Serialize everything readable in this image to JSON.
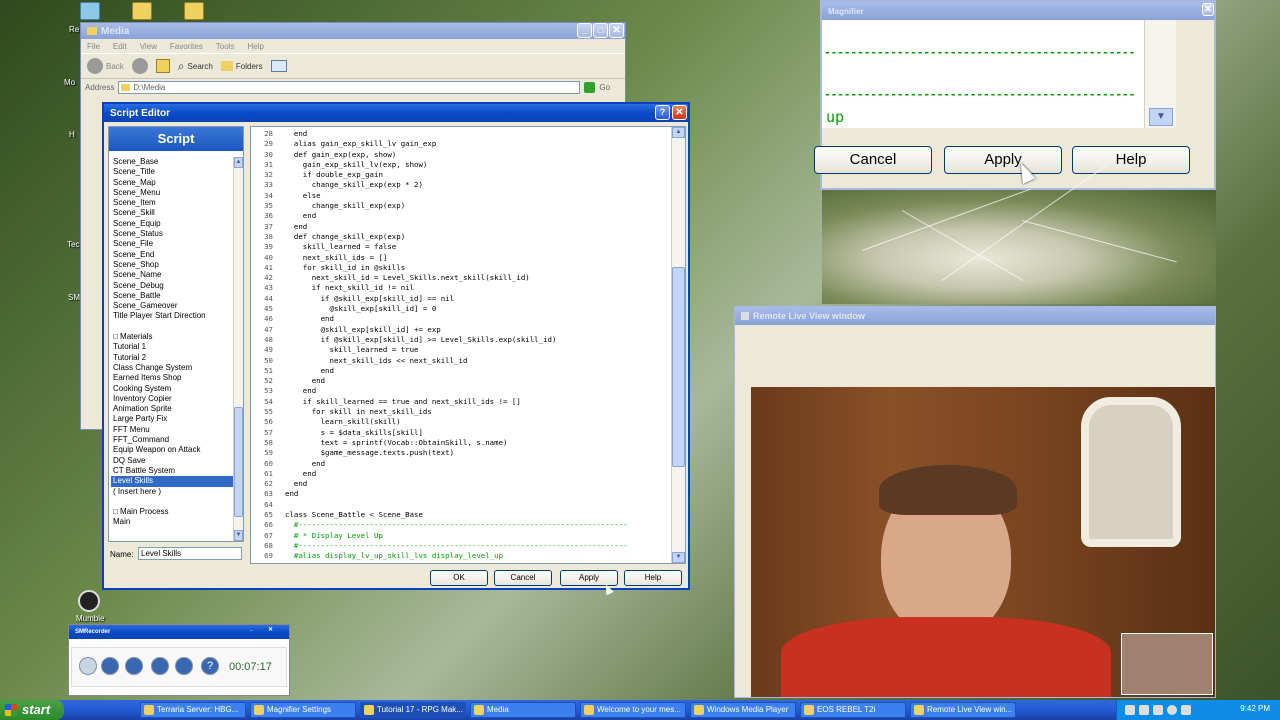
{
  "desktop": {
    "icons": [
      {
        "label": "Re"
      },
      {
        "label": "Mo"
      },
      {
        "label": "H"
      },
      {
        "label": "Tec"
      },
      {
        "label": "SM"
      },
      {
        "label": "Mumble"
      }
    ]
  },
  "explorer": {
    "title": "Media",
    "menu": [
      "File",
      "Edit",
      "View",
      "Favorites",
      "Tools",
      "Help"
    ],
    "toolbar": {
      "back": "Back",
      "search": "Search",
      "folders": "Folders"
    },
    "address_label": "Address",
    "address_value": "D:\\Media",
    "go": "Go"
  },
  "editor": {
    "title": "Script Editor",
    "help_glyph": "?",
    "list_header": "Script",
    "scripts": [
      "Scene_Base",
      "Scene_Title",
      "Scene_Map",
      "Scene_Menu",
      "Scene_Item",
      "Scene_Skill",
      "Scene_Equip",
      "Scene_Status",
      "Scene_File",
      "Scene_End",
      "Scene_Shop",
      "Scene_Name",
      "Scene_Debug",
      "Scene_Battle",
      "Scene_Gameover",
      "Title Player Start Direction",
      "",
      "□ Materials",
      "Tutorial 1",
      "Tutorial 2",
      "Class Change System",
      "Earned Items Shop",
      "Cooking System",
      "Inventory Copier",
      "Animation Sprite",
      "Large Party Fix",
      "FFT Menu",
      "FFT_Command",
      "Equip Weapon on Attack",
      "DQ Save",
      "CT Battle System",
      "Level Skills",
      "( Insert here )",
      "",
      "□ Main Process",
      "Main"
    ],
    "selected_index": 31,
    "name_label": "Name:",
    "name_value": "Level Skills",
    "code_lines": [
      {
        "n": "28",
        "t": "  end"
      },
      {
        "n": "29",
        "t": "  alias gain_exp_skill_lv gain_exp"
      },
      {
        "n": "30",
        "t": "  def gain_exp(exp, show)"
      },
      {
        "n": "31",
        "t": "    gain_exp_skill_lv(exp, show)"
      },
      {
        "n": "32",
        "t": "    if double_exp_gain"
      },
      {
        "n": "33",
        "t": "      change_skill_exp(exp * 2)"
      },
      {
        "n": "34",
        "t": "    else"
      },
      {
        "n": "35",
        "t": "      change_skill_exp(exp)"
      },
      {
        "n": "36",
        "t": "    end"
      },
      {
        "n": "37",
        "t": "  end"
      },
      {
        "n": "38",
        "t": "  def change_skill_exp(exp)"
      },
      {
        "n": "39",
        "t": "    skill_learned = false"
      },
      {
        "n": "40",
        "t": "    next_skill_ids = []"
      },
      {
        "n": "41",
        "t": "    for skill_id in @skills"
      },
      {
        "n": "42",
        "t": "      next_skill_id = Level_Skills.next_skill(skill_id)"
      },
      {
        "n": "43",
        "t": "      if next_skill_id != nil"
      },
      {
        "n": "44",
        "t": "        if @skill_exp[skill_id] == nil"
      },
      {
        "n": "45",
        "t": "          @skill_exp[skill_id] = 0"
      },
      {
        "n": "46",
        "t": "        end"
      },
      {
        "n": "47",
        "t": "        @skill_exp[skill_id] += exp"
      },
      {
        "n": "48",
        "t": "        if @skill_exp[skill_id] >= Level_Skills.exp(skill_id)"
      },
      {
        "n": "49",
        "t": "          skill_learned = true"
      },
      {
        "n": "50",
        "t": "          next_skill_ids << next_skill_id"
      },
      {
        "n": "51",
        "t": "        end"
      },
      {
        "n": "52",
        "t": "      end"
      },
      {
        "n": "53",
        "t": "    end"
      },
      {
        "n": "54",
        "t": "    if skill_learned == true and next_skill_ids != []"
      },
      {
        "n": "55",
        "t": "      for skill in next_skill_ids"
      },
      {
        "n": "56",
        "t": "        learn_skill(skill)"
      },
      {
        "n": "57",
        "t": "        s = $data_skills[skill]"
      },
      {
        "n": "58",
        "t": "        text = sprintf(Vocab::ObtainSkill, s.name)"
      },
      {
        "n": "59",
        "t": "        $game_message.texts.push(text)"
      },
      {
        "n": "60",
        "t": "      end"
      },
      {
        "n": "61",
        "t": "    end"
      },
      {
        "n": "62",
        "t": "  end"
      },
      {
        "n": "63",
        "t": "end"
      },
      {
        "n": "64",
        "t": ""
      },
      {
        "n": "65",
        "t": "class Scene_Battle < Scene_Base"
      },
      {
        "n": "66",
        "t": "  #--------------------------------------------------------------------------",
        "c": true
      },
      {
        "n": "67",
        "t": "  # * Display Level Up",
        "c": true
      },
      {
        "n": "68",
        "t": "  #--------------------------------------------------------------------------",
        "c": true
      },
      {
        "n": "69",
        "t": "  #alias display_lv_up_skill_lvs display_level_up",
        "c": true
      }
    ],
    "buttons": {
      "ok": "OK",
      "cancel": "Cancel",
      "apply": "Apply",
      "help": "Help"
    }
  },
  "magnifier": {
    "title": "Magnifier",
    "dashes1": "-----------------------------------------------",
    "dashes2": "-----------------------------------------------",
    "text": "up",
    "buttons": {
      "cancel": "Cancel",
      "apply": "Apply",
      "help": "Help"
    }
  },
  "liveview": {
    "title": "Remote Live View window"
  },
  "recorder": {
    "title": "SMRecorder",
    "time": "00:07:17"
  },
  "taskbar": {
    "start": "start",
    "tasks": [
      "Terraria Server: HBG...",
      "Magnifier Settings",
      "Tutorial 17 - RPG Mak...",
      "Media",
      "Welcome to your mes...",
      "Windows Media Player",
      "EOS REBEL T2i",
      "Remote Live View win..."
    ],
    "active_index": 2,
    "clock": "9:42 PM"
  },
  "colors": {
    "xp_blue": "#0a4bc8",
    "selection": "#316ac5",
    "comment_green": "#00a000",
    "taskbar": "#245edb",
    "start_green": "#2c8a2c"
  }
}
